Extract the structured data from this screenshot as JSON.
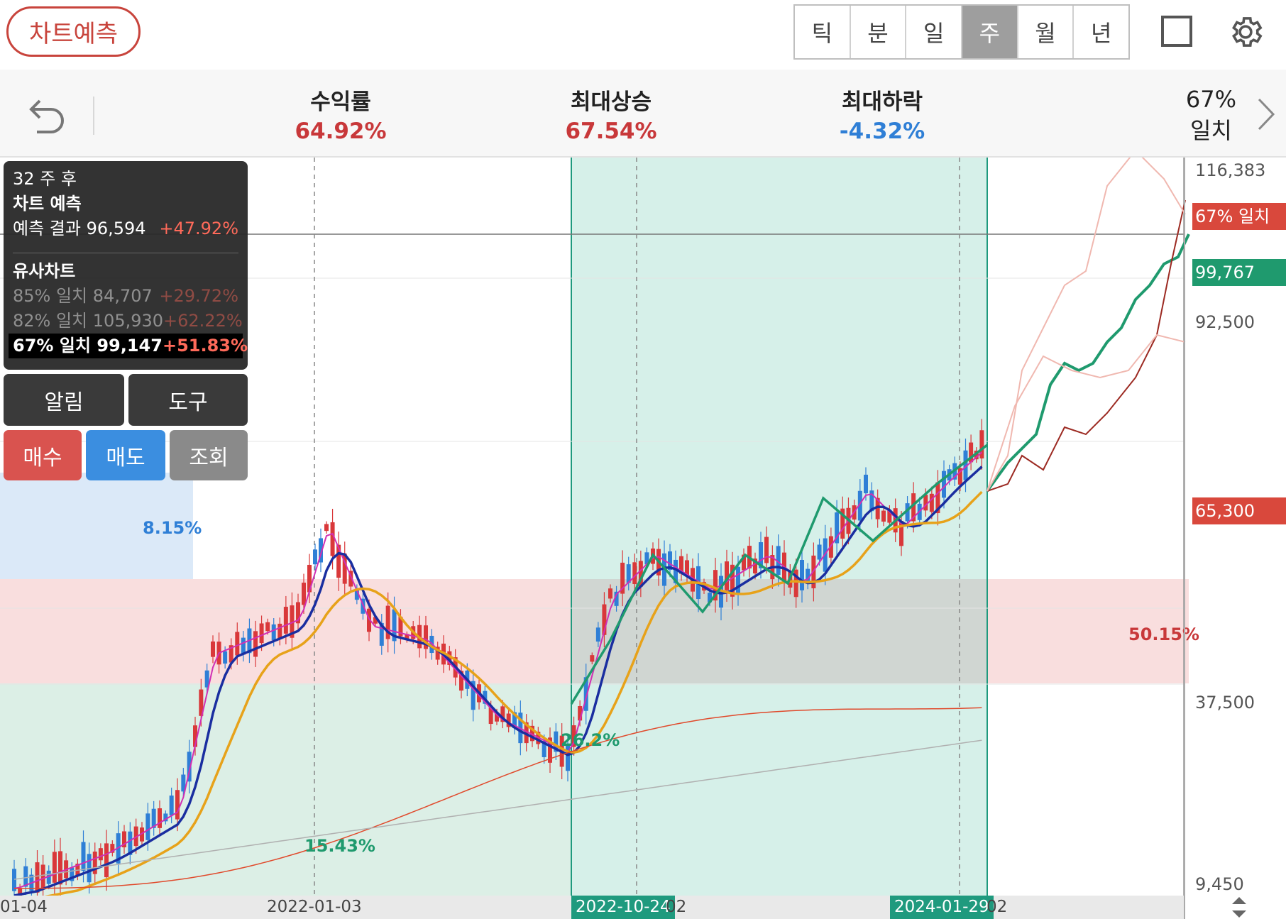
{
  "header": {
    "predict_button": "차트예측",
    "periods": [
      {
        "label": "틱",
        "active": false
      },
      {
        "label": "분",
        "active": false
      },
      {
        "label": "일",
        "active": false
      },
      {
        "label": "주",
        "active": true
      },
      {
        "label": "월",
        "active": false
      },
      {
        "label": "년",
        "active": false
      }
    ]
  },
  "stats": {
    "return_label": "수익률",
    "return_value": "64.92%",
    "max_up_label": "최대상승",
    "max_up_value": "67.54%",
    "max_down_label": "최대하락",
    "max_down_value": "-4.32%",
    "match_pct": "67%",
    "match_label": "일치"
  },
  "info_panel": {
    "weeks_after": "32 주 후",
    "title": "차트 예측",
    "result_label": "예측 결과",
    "result_value": "96,594",
    "result_change": "+47.92%",
    "similar_title": "유사차트",
    "similar": [
      {
        "label": "85% 일치",
        "value": "84,707",
        "change": "+29.72%"
      },
      {
        "label": "82% 일치",
        "value": "105,930",
        "change": "+62.22%"
      },
      {
        "label": "67% 일치",
        "value": "99,147",
        "change": "+51.83%"
      }
    ]
  },
  "buttons": {
    "alert": "알림",
    "tools": "도구",
    "buy": "매수",
    "sell": "매도",
    "view": "조회"
  },
  "axis": {
    "y_labels": [
      "116,383",
      "92,500",
      "37,500",
      "9,450"
    ],
    "tag_match": "67% 일치",
    "tag_current": "99,767",
    "tag_price": "65,300",
    "x_labels": [
      "01-04",
      "2022-01-03",
      "2022-10-24",
      "2024-01-29"
    ],
    "x_suffix": "02",
    "x_suffix2": "02"
  },
  "overlays": {
    "blue_zone_pct": "8.15%",
    "red_zone_pct": "50.15%",
    "green_zone_pct": "15.43%",
    "green_zone2_pct": "26.2%"
  },
  "colors": {
    "up": "#d9383a",
    "down": "#2f7fd6",
    "ma5": "#d12fb4",
    "ma20": "#1a2ea0",
    "ma60": "#e7a21a",
    "ma120": "#e04a2c",
    "ma240": "#b0b0b0",
    "forecast": "#1f9a6e",
    "match_line": "#9c2a22"
  }
}
